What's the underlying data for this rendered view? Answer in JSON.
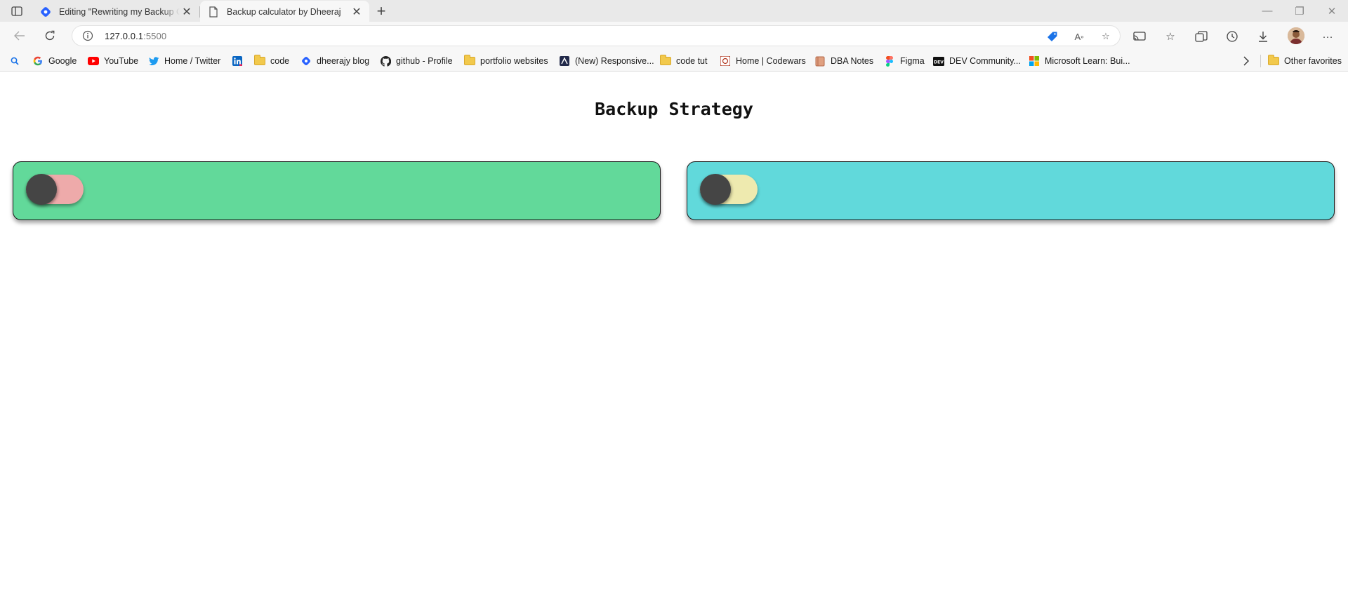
{
  "browser": {
    "tabs": [
      {
        "title": "Editing \"Rewriting my Backup Calculator\"",
        "active": false,
        "favicon": "hashnode-icon"
      },
      {
        "title": "Backup calculator by Dheeraj",
        "active": true,
        "favicon": "page-icon"
      }
    ],
    "address": {
      "host": "127.0.0.1",
      "port": ":5500"
    },
    "bookmarks": [
      {
        "label": "",
        "icon": "search-icon"
      },
      {
        "label": "Google",
        "icon": "google-icon"
      },
      {
        "label": "YouTube",
        "icon": "youtube-icon"
      },
      {
        "label": "Home / Twitter",
        "icon": "twitter-icon"
      },
      {
        "label": "",
        "icon": "linkedin-icon"
      },
      {
        "label": "code",
        "icon": "folder-icon"
      },
      {
        "label": "dheerajy blog",
        "icon": "hashnode-icon"
      },
      {
        "label": "github - Profile",
        "icon": "github-icon"
      },
      {
        "label": "portfolio websites",
        "icon": "folder-icon"
      },
      {
        "label": "(New) Responsive...",
        "icon": "frontendmentor-icon"
      },
      {
        "label": "code tut",
        "icon": "folder-icon"
      },
      {
        "label": "Home | Codewars",
        "icon": "codewars-icon"
      },
      {
        "label": "DBA Notes",
        "icon": "notebook-icon"
      },
      {
        "label": "Figma",
        "icon": "figma-icon"
      },
      {
        "label": "DEV Community...",
        "icon": "dev-icon"
      },
      {
        "label": "Microsoft Learn: Bui...",
        "icon": "microsoft-icon"
      }
    ],
    "other_favorites": "Other favorites"
  },
  "page": {
    "title": "Backup Strategy",
    "cards": [
      {
        "color": "#62d99a",
        "toggle_track_color": "#eeaaaa",
        "toggle_on": false
      },
      {
        "color": "#61d9db",
        "toggle_track_color": "#eeeaaf",
        "toggle_on": false
      }
    ]
  }
}
